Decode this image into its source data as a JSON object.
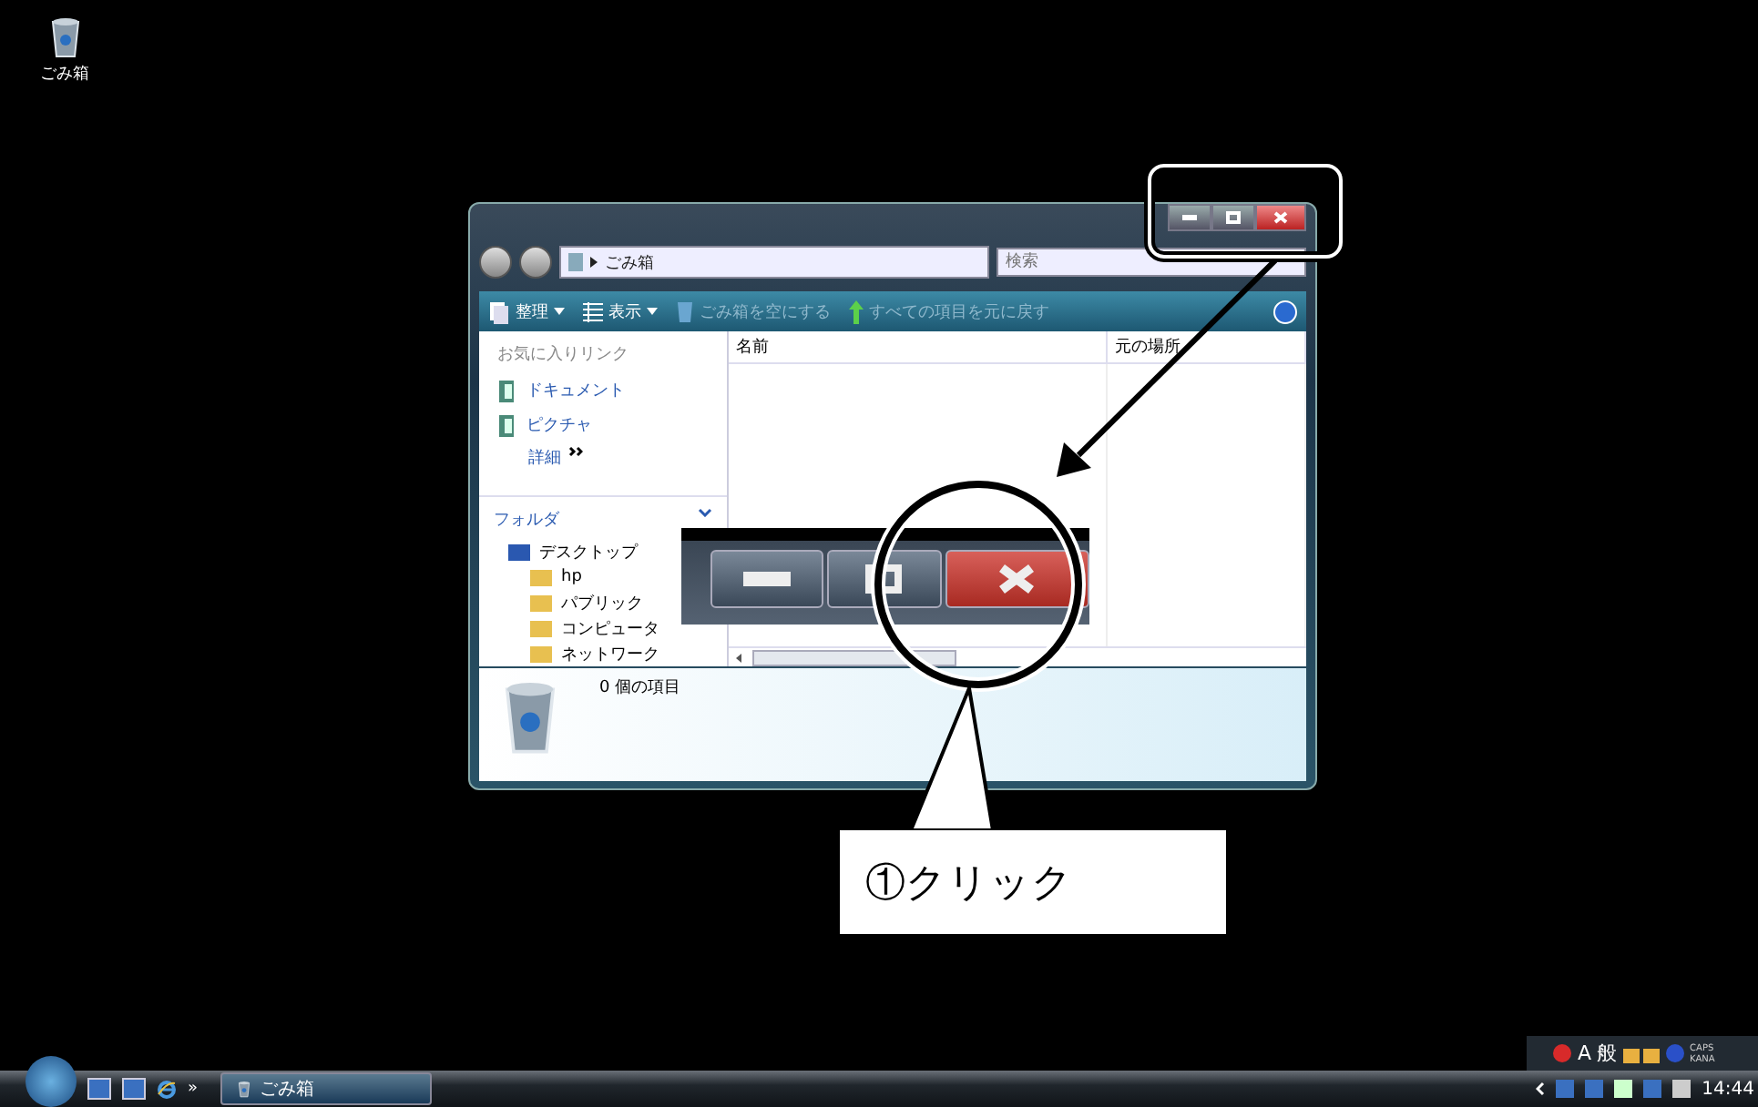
{
  "desktop": {
    "icons": [
      {
        "label": "ごみ箱"
      }
    ]
  },
  "window": {
    "address": "ごみ箱",
    "search": {
      "placeholder": "検索"
    },
    "toolbar": [
      {
        "label": "整理",
        "kind": "menu",
        "disabled": false
      },
      {
        "label": "表示",
        "kind": "menu",
        "disabled": false
      },
      {
        "label": "ごみ箱を空にする",
        "kind": "action",
        "disabled": true
      },
      {
        "label": "すべての項目を元に戻す",
        "kind": "action",
        "disabled": true
      }
    ],
    "favorites": {
      "title": "お気に入りリンク",
      "items": [
        "ドキュメント",
        "ピクチャ"
      ],
      "more": "詳細"
    },
    "folders": {
      "title": "フォルダ",
      "tree": [
        {
          "label": "デスクトップ",
          "children": [
            {
              "label": "hp"
            },
            {
              "label": "パブリック"
            },
            {
              "label": "コンピュータ"
            },
            {
              "label": "ネットワーク"
            }
          ]
        }
      ]
    },
    "columns": [
      "名前",
      "元の場所"
    ],
    "status": "0 個の項目"
  },
  "callout": {
    "text": "①クリック"
  },
  "language_bar": {
    "mode": "A",
    "ime": "般",
    "caps": "CAPS",
    "kana": "KANA"
  },
  "taskbar": {
    "buttons": [
      {
        "label": "ごみ箱",
        "selected": true
      }
    ],
    "more": "»",
    "clock": "14:44"
  }
}
